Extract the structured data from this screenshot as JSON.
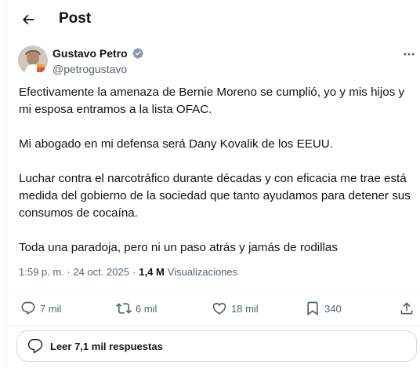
{
  "header": {
    "title": "Post"
  },
  "author": {
    "name": "Gustavo Petro",
    "handle": "@petrogustavo"
  },
  "tweet": {
    "paragraphs": [
      "Efectivamente la amenaza de Bernie Moreno se cumplió, yo y mis hijos y mi esposa entramos a la lista OFAC.",
      "Mi abogado en mi defensa será Dany Kovalik de los EEUU.",
      "Luchar contra el narcotráfico durante  décadas y con eficacia me trae está medida del gobierno de la sociedad que tanto ayudamos para detener sus consumos de cocaína.",
      "Toda una paradoja, pero ni un paso atrás y jamás de rodillas"
    ]
  },
  "meta": {
    "timestamp": "1:59 p. m. · 24 oct. 2025",
    "separator": "·",
    "views_count": "1,4 M",
    "views_label": "Visualizaciones"
  },
  "actions": {
    "replies": "7 mil",
    "reposts": "6 mil",
    "likes": "18 mil",
    "bookmarks": "340"
  },
  "replies_button": {
    "label": "Leer 7,1 mil respuestas"
  },
  "colors": {
    "text": "#0f1419",
    "secondary": "#536471",
    "verified": "#829aab",
    "border": "#eff3f4"
  }
}
